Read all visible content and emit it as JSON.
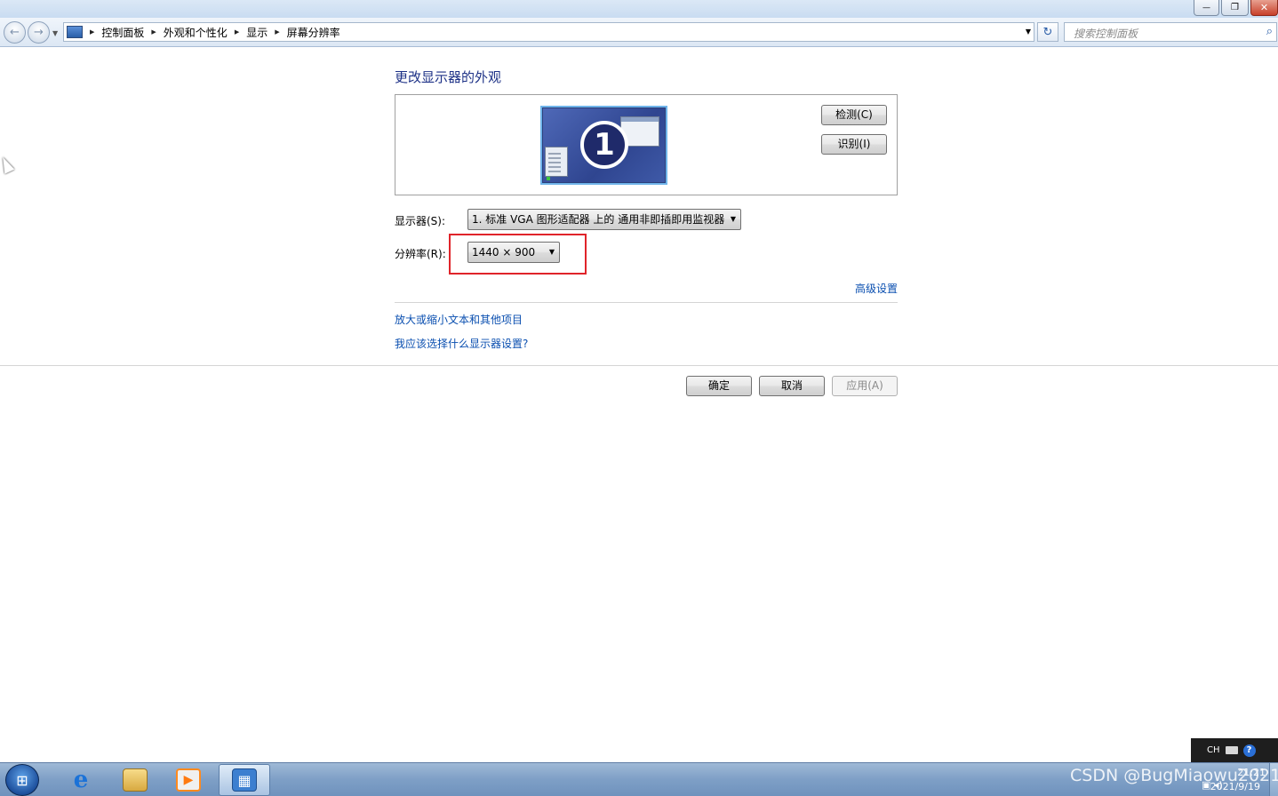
{
  "window": {
    "controls": {
      "minimize": "—",
      "maximize": "❐",
      "close": "✕"
    }
  },
  "navbar": {
    "back_icon": "←",
    "forward_icon": "→",
    "breadcrumbs": [
      "控制面板",
      "外观和个性化",
      "显示",
      "屏幕分辨率"
    ],
    "search_placeholder": "搜索控制面板",
    "search_icon": "⌕",
    "refresh_icon": "↻"
  },
  "main": {
    "title": "更改显示器的外观",
    "monitor_number": "1",
    "detect_label": "检测(C)",
    "identify_label": "识别(I)",
    "display_label": "显示器(S):",
    "display_value": "1. 标准 VGA 图形适配器 上的 通用非即插即用监视器",
    "resolution_label": "分辨率(R):",
    "resolution_value": "1440 × 900",
    "advanced_link": "高级设置",
    "text_size_link": "放大或缩小文本和其他项目",
    "which_settings_link": "我应该选择什么显示器设置?",
    "ok_label": "确定",
    "cancel_label": "取消",
    "apply_label": "应用(A)"
  },
  "langbar": {
    "lang": "CH",
    "help": "?"
  },
  "taskbar": {
    "start_icon": "⊞",
    "ie_icon": "e",
    "media_icon": "▶",
    "control_icon": "▦",
    "clock_time": "21:21",
    "clock_date": "2021/9/19"
  },
  "watermark": "CSDN @BugMiaowu2021",
  "colors": {
    "link": "#0a4fb0",
    "title": "#1e3287",
    "highlight": "#e0242a",
    "taskbar": "#7e9fc6"
  }
}
